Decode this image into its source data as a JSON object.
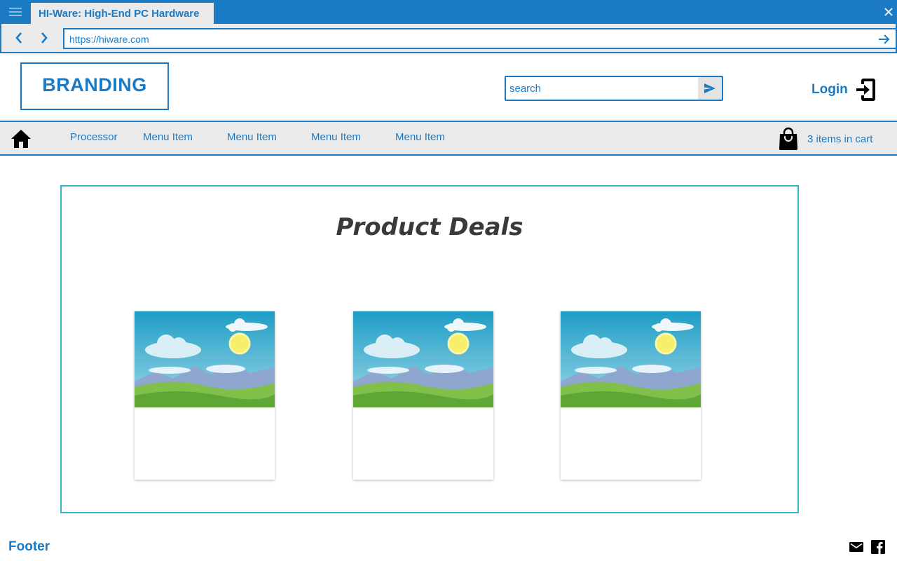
{
  "browser": {
    "tab_title": "HI-Ware: High-End PC Hardware",
    "url": "https://hiware.com"
  },
  "header": {
    "branding": "BRANDING",
    "search_placeholder": "search",
    "login_label": "Login"
  },
  "menu": {
    "items": [
      {
        "label": "Processor"
      },
      {
        "label": "Menu Item"
      },
      {
        "label": "Menu Item"
      },
      {
        "label": "Menu Item"
      },
      {
        "label": "Menu Item"
      }
    ],
    "cart_label": "3 items in cart"
  },
  "main": {
    "title": "Product Deals",
    "cards": [
      {
        "image": "landscape-placeholder"
      },
      {
        "image": "landscape-placeholder"
      },
      {
        "image": "landscape-placeholder"
      }
    ]
  },
  "footer": {
    "label": "Footer",
    "icons": [
      "mail-icon",
      "facebook-icon"
    ]
  },
  "colors": {
    "accent": "#1a7ac4",
    "panel_border": "#2fb6c8",
    "bar_background": "#eaeaea",
    "title_text": "#3a3a3a"
  }
}
